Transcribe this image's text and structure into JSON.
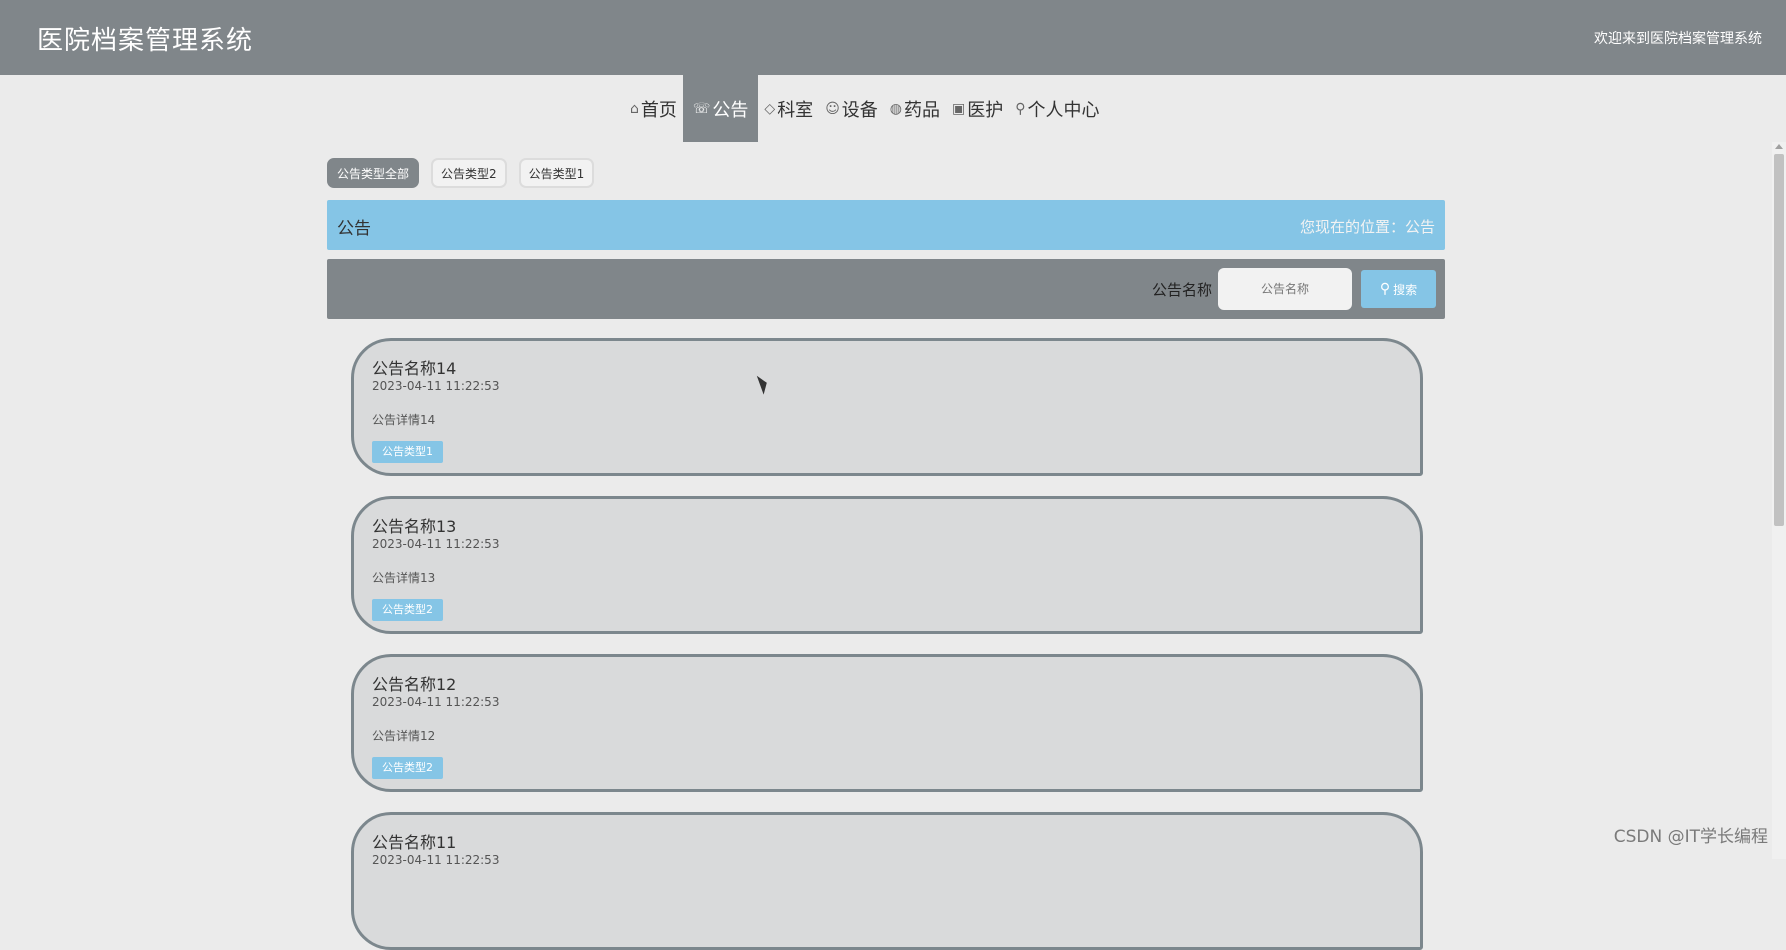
{
  "header": {
    "title": "医院档案管理系统",
    "welcome": "欢迎来到医院档案管理系统"
  },
  "nav": {
    "items": [
      {
        "icon": "⌂",
        "icon_name": "home-icon",
        "label": "首页",
        "active": false
      },
      {
        "icon": "☏",
        "icon_name": "announcement-icon",
        "label": "公告",
        "active": true
      },
      {
        "icon": "⌂",
        "icon_name": "tag-icon",
        "label": "科室",
        "active": false
      },
      {
        "icon": "☺",
        "icon_name": "device-icon",
        "label": "设备",
        "active": false
      },
      {
        "icon": "◍",
        "icon_name": "medicine-icon",
        "label": "药品",
        "active": false
      },
      {
        "icon": "▣",
        "icon_name": "clipboard-icon",
        "label": "医护",
        "active": false
      },
      {
        "icon": "⚲",
        "icon_name": "user-icon",
        "label": "个人中心",
        "active": false
      }
    ]
  },
  "filters": [
    {
      "label": "公告类型全部",
      "active": true
    },
    {
      "label": "公告类型2",
      "active": false
    },
    {
      "label": "公告类型1",
      "active": false
    }
  ],
  "banner": {
    "title": "公告",
    "location": "您现在的位置：公告"
  },
  "search": {
    "label": "公告名称",
    "placeholder": "公告名称",
    "button_label": "搜索",
    "button_icon": "search-icon"
  },
  "cards": [
    {
      "title": "公告名称14",
      "time": "2023-04-11 11:22:53",
      "desc": "公告详情14",
      "type": "公告类型1"
    },
    {
      "title": "公告名称13",
      "time": "2023-04-11 11:22:53",
      "desc": "公告详情13",
      "type": "公告类型2"
    },
    {
      "title": "公告名称12",
      "time": "2023-04-11 11:22:53",
      "desc": "公告详情12",
      "type": "公告类型2"
    },
    {
      "title": "公告名称11",
      "time": "2023-04-11 11:22:53",
      "desc": "",
      "type": ""
    }
  ],
  "watermark": "CSDN @IT学长编程",
  "colors": {
    "header_bg": "#80868a",
    "accent_blue": "#85c5e6",
    "page_bg": "#ebebeb",
    "card_bg": "#d9dadb",
    "card_border": "#7c878d"
  }
}
